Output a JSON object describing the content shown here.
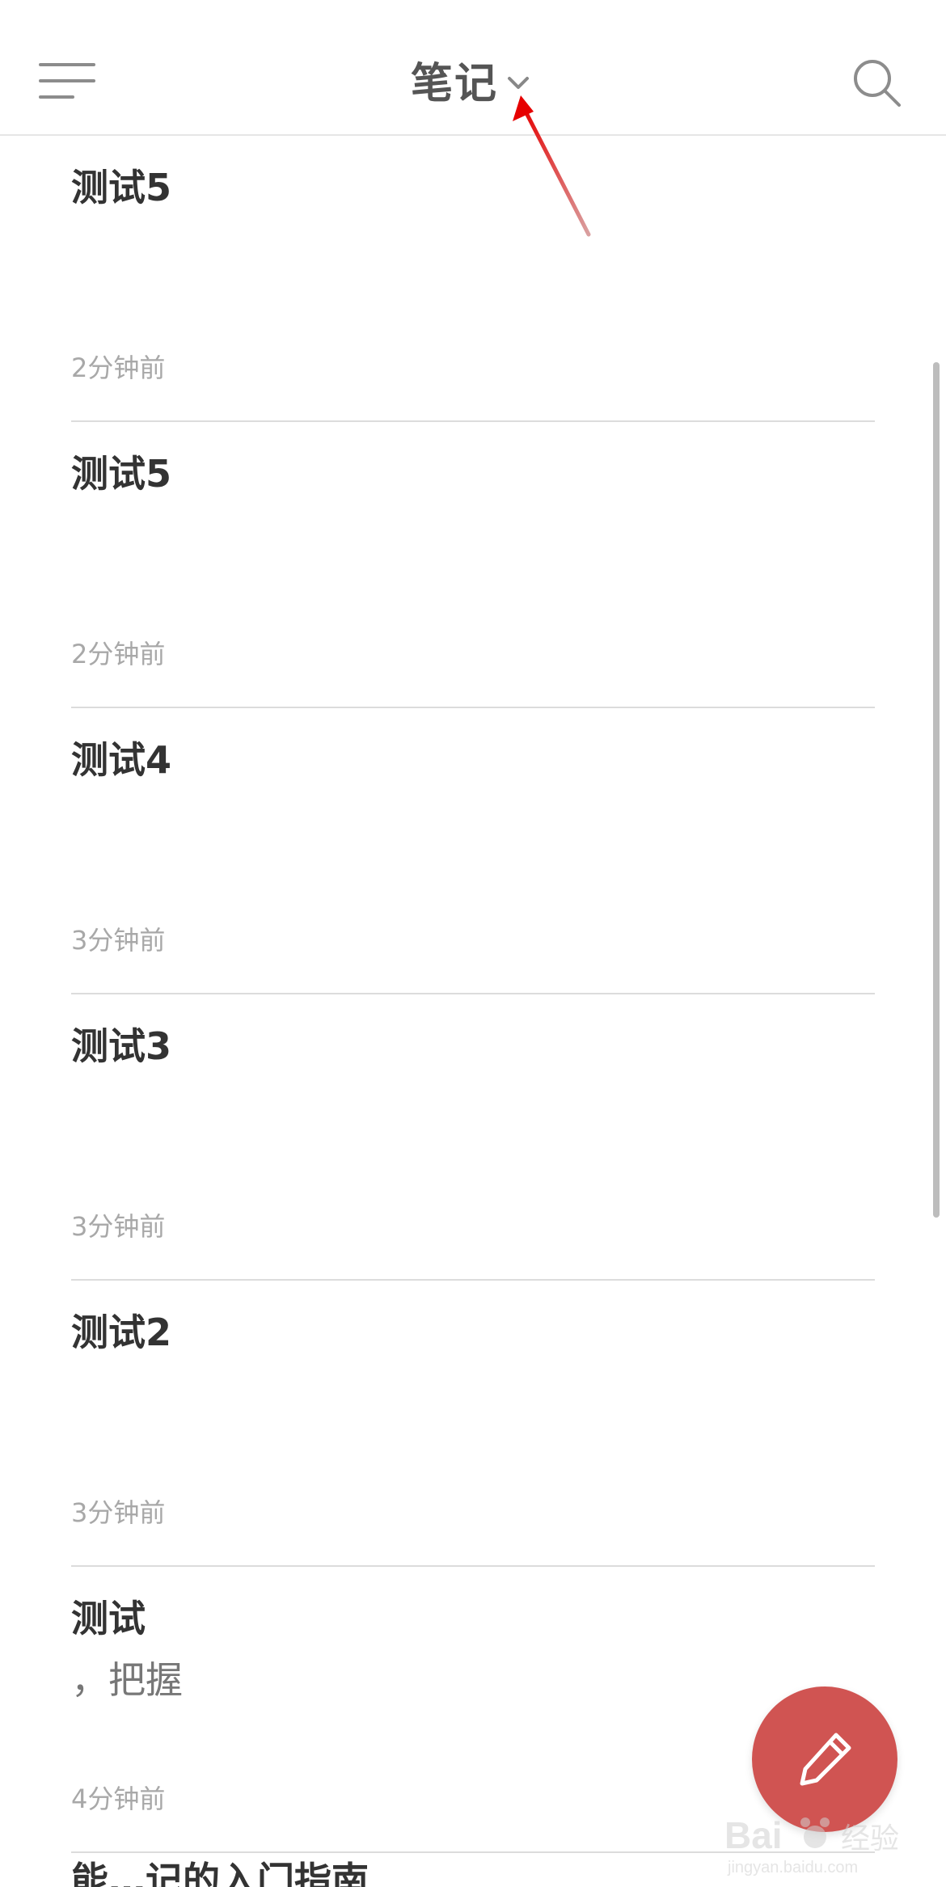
{
  "header": {
    "title": "笔记",
    "menu_icon": "hamburger-menu-icon",
    "dropdown_icon": "chevron-down-icon",
    "search_icon": "search-icon"
  },
  "notes": [
    {
      "title": "测试5",
      "snippet": "",
      "time": "2分钟前"
    },
    {
      "title": "测试5",
      "snippet": "",
      "time": "2分钟前"
    },
    {
      "title": "测试4",
      "snippet": "",
      "time": "3分钟前"
    },
    {
      "title": "测试3",
      "snippet": "",
      "time": "3分钟前"
    },
    {
      "title": "测试2",
      "snippet": "",
      "time": "3分钟前"
    },
    {
      "title": "测试",
      "snippet": "，把握",
      "time": "4分钟前"
    }
  ],
  "partial_note": {
    "title": "能…记的入门指南"
  },
  "fab": {
    "icon": "pencil-icon"
  },
  "colors": {
    "accent": "#d05452",
    "annotation_arrow": "#e02020",
    "divider": "#dcdcdc"
  }
}
